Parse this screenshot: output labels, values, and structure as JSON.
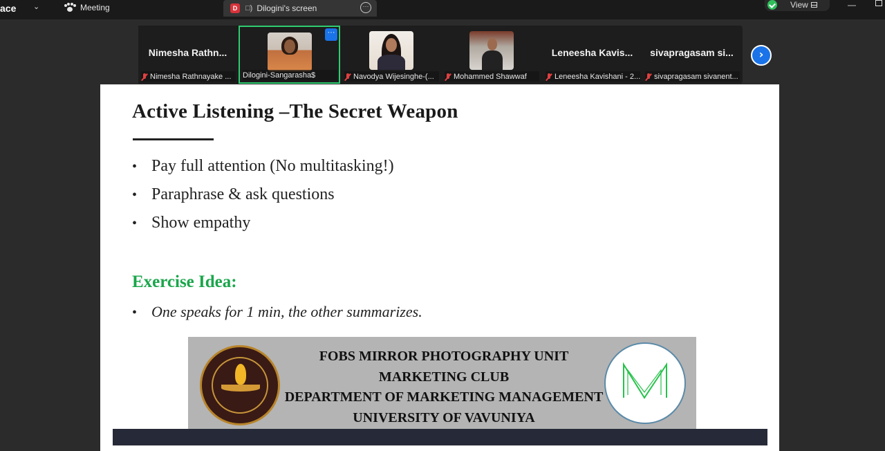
{
  "topbar": {
    "app_partial": "ace",
    "meeting_label": "Meeting",
    "share_tab_initial": "D",
    "share_tab_label": "Dilogini's screen",
    "view_label": "View"
  },
  "participants": [
    {
      "big_name": "Nimesha  Rathn...",
      "label": "Nimesha Rathnayake ...",
      "muted": true
    },
    {
      "big_name": "",
      "label": "Dilogini-Sangarasha$",
      "muted": false,
      "active": true
    },
    {
      "big_name": "",
      "label": "Navodya Wijesinghe-(...",
      "muted": true
    },
    {
      "big_name": "",
      "label": "Mohammed Shawwaf",
      "muted": true
    },
    {
      "big_name": "Leneesha  Kavis...",
      "label": "Leneesha Kavishani - 2...",
      "muted": true
    },
    {
      "big_name": "sivapragasam  si...",
      "label": "sivapragasam sivanent...",
      "muted": true
    }
  ],
  "slide": {
    "title": "Active Listening –The Secret Weapon",
    "bullets": [
      "Pay full attention (No multitasking!)",
      "Paraphrase & ask questions",
      "Show empathy"
    ],
    "exercise_title": "Exercise Idea:",
    "exercise_item": "One speaks for 1 min, the other summarizes.",
    "banner_lines": [
      "FOBS MIRROR PHOTOGRAPHY UNIT",
      "MARKETING CLUB",
      "DEPARTMENT OF MARKETING MANAGEMENT",
      "UNIVERSITY OF VAVUNIYA"
    ]
  },
  "colors": {
    "active_border": "#2ecc71",
    "accent_blue": "#1a73e8",
    "exercise_green": "#1aa64b",
    "muted_red": "#e04040"
  },
  "icons": [
    "chevron-down-icon",
    "paw-icon",
    "speaker-icon",
    "more-icon",
    "shield-check-icon",
    "grid-icon",
    "minimize-icon",
    "restore-icon",
    "mic-off-icon",
    "chevron-right-icon"
  ]
}
